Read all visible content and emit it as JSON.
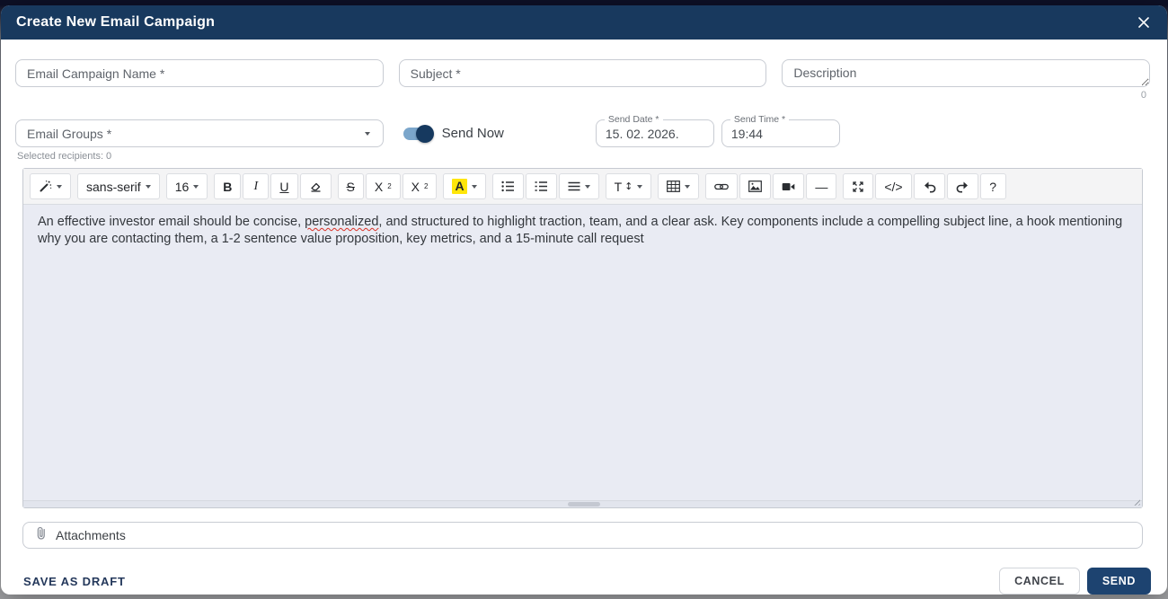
{
  "header": {
    "title": "Create New Email Campaign"
  },
  "form": {
    "campaign_name_placeholder": "Email Campaign Name *",
    "subject_placeholder": "Subject *",
    "description_placeholder": "Description",
    "description_counter": "0",
    "email_groups_placeholder": "Email Groups *",
    "selected_recipients": "Selected recipients: 0",
    "send_now_label": "Send Now",
    "send_date_label": "Send Date *",
    "send_date_value": "15. 02. 2026.",
    "send_time_label": "Send Time *",
    "send_time_value": "19:44"
  },
  "editor": {
    "toolbar": {
      "font_name": "sans-serif",
      "font_size": "16",
      "bold": "B",
      "italic": "I",
      "underline": "U",
      "strikethrough": "S",
      "superscript_base": "X",
      "superscript_mark": "2",
      "subscript_base": "X",
      "subscript_mark": "2",
      "color_label": "A",
      "height_base": "T",
      "height_arrow": "↕",
      "hr_label": "—",
      "codeview_label": "</>",
      "help_label": "?"
    },
    "body_part1": "An effective investor email should be concise, ",
    "body_misspelled": "personalized",
    "body_part2": ", and structured to highlight traction, team, and a clear ask. Key components include a compelling subject line, a hook mentioning why you are contacting them, a 1-2 sentence value proposition, key metrics, and a 15-minute call request"
  },
  "attachments": {
    "label": "Attachments"
  },
  "footer": {
    "save_draft_label": "SAVE AS DRAFT",
    "cancel_label": "CANCEL",
    "send_label": "SEND"
  },
  "colors": {
    "header_bg": "#18395e",
    "primary_button": "#1d4370",
    "toggle_track": "#7ba6cb",
    "toggle_thumb": "#16395f",
    "editor_bg": "#e9ebf3",
    "highlight_yellow": "#ffe60a",
    "spellcheck_red": "#d93025"
  }
}
